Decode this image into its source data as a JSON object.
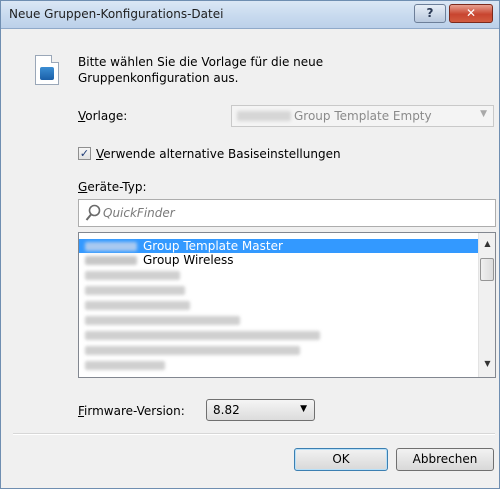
{
  "window": {
    "title": "Neue Gruppen-Konfigurations-Datei",
    "help_label": "?",
    "close_label": "✕"
  },
  "instruction": {
    "line1": "Bitte wählen Sie die Vorlage für die neue",
    "line2": "Gruppenkonfiguration aus."
  },
  "template": {
    "label_first": "V",
    "label_rest": "orlage:",
    "selected": "Group Template Empty"
  },
  "alt_settings": {
    "checked": true,
    "check_mark": "✓",
    "label_first": "V",
    "label_rest": "erwende alternative Basiseinstellungen"
  },
  "device_type": {
    "label_first": "G",
    "label_rest": "eräte-Typ:",
    "search_placeholder": "QuickFinder",
    "items": [
      {
        "label": "Group Template Master",
        "selected": true
      },
      {
        "label": "Group Wireless",
        "selected": false
      }
    ]
  },
  "firmware": {
    "label_first": "F",
    "label_rest": "irmware-Version:",
    "value": "8.82"
  },
  "buttons": {
    "ok": "OK",
    "cancel": "Abbrechen"
  },
  "colors": {
    "selection": "#3399ff",
    "title_bar": "#c9dbef",
    "close_button": "#c8452f"
  }
}
